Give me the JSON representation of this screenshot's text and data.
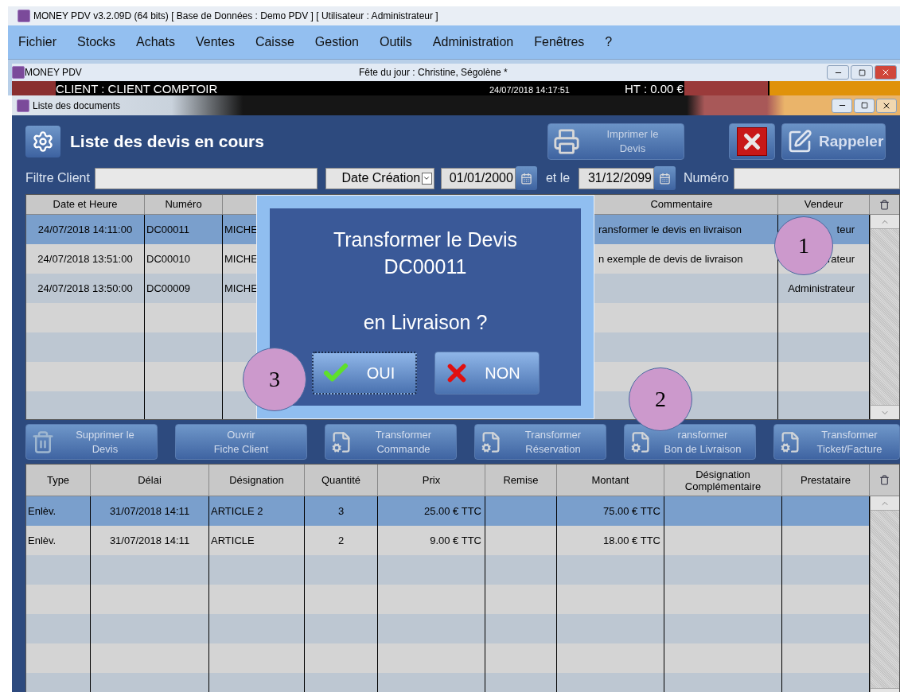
{
  "app_window": {
    "title": "MONEY PDV v3.2.09D (64 bits) [ Base de Données : Demo PDV ] [ Utilisateur : Administrateur ]"
  },
  "menu": [
    "Fichier",
    "Stocks",
    "Achats",
    "Ventes",
    "Caisse",
    "Gestion",
    "Outils",
    "Administration",
    "Fenêtres",
    "?"
  ],
  "pos_window": {
    "title": "MONEY PDV",
    "notice": "Fête du jour : Christine, Ségolène *",
    "client": "CLIENT : CLIENT COMPTOIR",
    "datetime": "24/07/2018 14:17:51",
    "total": "HT : 0.00 €"
  },
  "documents_window": {
    "title": "Liste des documents",
    "heading": "Liste des devis en cours"
  },
  "top_buttons": [
    {
      "kind": "print",
      "lines": [
        "Imprimer le",
        "Devis"
      ]
    },
    {
      "kind": "cancel"
    },
    {
      "kind": "recall",
      "lines": [
        "Rappeler"
      ]
    }
  ],
  "filter": {
    "client_label": "Filtre Client",
    "date_field": "Date Création",
    "date_from": "01/01/2000",
    "between": "et le",
    "date_to": "31/12/2099",
    "number_label": "Numéro"
  },
  "quotes_table": {
    "columns": [
      "Date et Heure",
      "Numéro",
      "Commentaire",
      "Vendeur"
    ],
    "rows": [
      {
        "selected": true,
        "date": "24/07/2018 14:11:00",
        "number": "DC00011",
        "column_3": "MICHE",
        "comment": "ransformer le devis en livraison",
        "vendor": "teur"
      },
      {
        "selected": false,
        "date": "24/07/2018 13:51:00",
        "number": "DC00010",
        "column_3": "MICHE",
        "comment": "n exemple de devis de livraison",
        "vendor": "rateur"
      },
      {
        "selected": false,
        "date": "24/07/2018 13:50:00",
        "number": "DC00009",
        "column_3": "MICHE",
        "vendor": "Administrateur"
      }
    ]
  },
  "action_buttons": [
    {
      "kind": "delete",
      "lines": [
        "Supprimer le",
        "Devis"
      ]
    },
    {
      "kind": "customer",
      "lines": [
        "Ouvrir",
        "Fiche Client"
      ]
    },
    {
      "kind": "transform",
      "lines": [
        "Transformer",
        "Commande"
      ]
    },
    {
      "kind": "transform",
      "lines": [
        "Transformer",
        "Réservation"
      ]
    },
    {
      "kind": "transform",
      "lines": [
        "ransformer",
        "Bon de Livraison"
      ]
    },
    {
      "kind": "transform",
      "lines": [
        "Transformer",
        "Ticket/Facture"
      ]
    }
  ],
  "lines_table": {
    "columns": [
      "Type",
      "Délai",
      "Désignation",
      "Quantité",
      "Prix",
      "Remise",
      "Montant",
      "Désignation Complémentaire",
      "Prestataire"
    ],
    "rows": [
      {
        "selected": true,
        "type": "Enlèv.",
        "delay": "31/07/2018 14:11",
        "designation": "ARTICLE 2",
        "quantity": "3",
        "price": "25.00 € TTC",
        "amount": "75.00 € TTC"
      },
      {
        "selected": false,
        "type": "Enlèv.",
        "delay": "31/07/2018 14:11",
        "designation": "ARTICLE",
        "quantity": "2",
        "price": "9.00 € TTC",
        "amount": "18.00 € TTC"
      }
    ]
  },
  "dialog": {
    "lines": [
      "Transformer le Devis",
      "DC00011",
      "en Livraison ?"
    ],
    "buttons": [
      {
        "kind": "yes",
        "label": "OUI",
        "focused": true
      },
      {
        "kind": "no",
        "label": "NON",
        "focused": false
      }
    ]
  },
  "callouts": [
    {
      "label": "1"
    },
    {
      "label": "2"
    },
    {
      "label": "3"
    }
  ]
}
